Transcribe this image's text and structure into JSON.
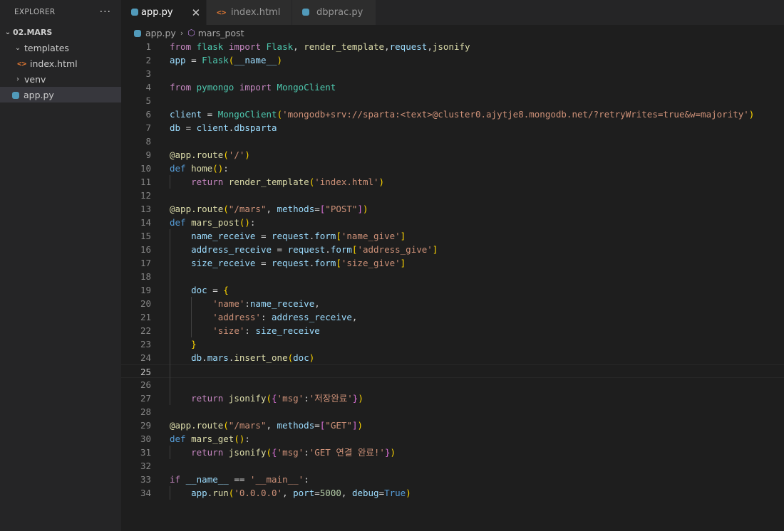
{
  "sidebar": {
    "title": "EXPLORER",
    "more": "···",
    "root": "02.MARS",
    "items": [
      {
        "label": "templates"
      },
      {
        "label": "index.html"
      },
      {
        "label": "venv"
      },
      {
        "label": "app.py"
      }
    ]
  },
  "tabs": [
    {
      "label": "app.py",
      "close": "✕"
    },
    {
      "label": "index.html"
    },
    {
      "label": "dbprac.py"
    }
  ],
  "breadcrumb": {
    "file": "app.py",
    "symbol": "mars_post"
  },
  "editor": {
    "line_numbers": [
      "1",
      "2",
      "3",
      "4",
      "5",
      "6",
      "7",
      "8",
      "9",
      "10",
      "11",
      "12",
      "13",
      "14",
      "15",
      "16",
      "17",
      "18",
      "19",
      "20",
      "21",
      "22",
      "23",
      "24",
      "25",
      "26",
      "27",
      "28",
      "29",
      "30",
      "31",
      "32",
      "33",
      "34"
    ],
    "lines": [
      [
        [
          "kw",
          "from"
        ],
        [
          "plain",
          " "
        ],
        [
          "cls",
          "flask"
        ],
        [
          "plain",
          " "
        ],
        [
          "kw",
          "import"
        ],
        [
          "plain",
          " "
        ],
        [
          "cls",
          "Flask"
        ],
        [
          "plain",
          ", "
        ],
        [
          "fn",
          "render_template"
        ],
        [
          "plain",
          ","
        ],
        [
          "var",
          "request"
        ],
        [
          "plain",
          ","
        ],
        [
          "fn",
          "jsonify"
        ]
      ],
      [
        [
          "var",
          "app"
        ],
        [
          "plain",
          " = "
        ],
        [
          "cls",
          "Flask"
        ],
        [
          "brk1",
          "("
        ],
        [
          "var",
          "__name__"
        ],
        [
          "brk1",
          ")"
        ]
      ],
      [],
      [
        [
          "kw",
          "from"
        ],
        [
          "plain",
          " "
        ],
        [
          "cls",
          "pymongo"
        ],
        [
          "plain",
          " "
        ],
        [
          "kw",
          "import"
        ],
        [
          "plain",
          " "
        ],
        [
          "cls",
          "MongoClient"
        ]
      ],
      [],
      [
        [
          "var",
          "client"
        ],
        [
          "plain",
          " = "
        ],
        [
          "cls",
          "MongoClient"
        ],
        [
          "brk1",
          "("
        ],
        [
          "str",
          "'mongodb+srv://sparta:<text>@cluster0.ajytje8.mongodb.net/?retryWrites=true&w=majority'"
        ],
        [
          "brk1",
          ")"
        ]
      ],
      [
        [
          "var",
          "db"
        ],
        [
          "plain",
          " = "
        ],
        [
          "var",
          "client"
        ],
        [
          "plain",
          "."
        ],
        [
          "var",
          "dbsparta"
        ]
      ],
      [],
      [
        [
          "fn",
          "@app.route"
        ],
        [
          "brk1",
          "("
        ],
        [
          "str",
          "'/'"
        ],
        [
          "brk1",
          ")"
        ]
      ],
      [
        [
          "def",
          "def"
        ],
        [
          "plain",
          " "
        ],
        [
          "fn",
          "home"
        ],
        [
          "brk1",
          "()"
        ],
        [
          "plain",
          ":"
        ]
      ],
      [
        [
          "plain",
          "    "
        ],
        [
          "kw",
          "return"
        ],
        [
          "plain",
          " "
        ],
        [
          "fn",
          "render_template"
        ],
        [
          "brk1",
          "("
        ],
        [
          "str",
          "'index.html'"
        ],
        [
          "brk1",
          ")"
        ]
      ],
      [],
      [
        [
          "fn",
          "@app.route"
        ],
        [
          "brk1",
          "("
        ],
        [
          "str",
          "\"/mars\""
        ],
        [
          "plain",
          ", "
        ],
        [
          "var",
          "methods"
        ],
        [
          "plain",
          "="
        ],
        [
          "brk2",
          "["
        ],
        [
          "str",
          "\"POST\""
        ],
        [
          "brk2",
          "]"
        ],
        [
          "brk1",
          ")"
        ]
      ],
      [
        [
          "def",
          "def"
        ],
        [
          "plain",
          " "
        ],
        [
          "fn",
          "mars_post"
        ],
        [
          "brk1",
          "()"
        ],
        [
          "plain",
          ":"
        ]
      ],
      [
        [
          "plain",
          "    "
        ],
        [
          "var",
          "name_receive"
        ],
        [
          "plain",
          " = "
        ],
        [
          "var",
          "request"
        ],
        [
          "plain",
          "."
        ],
        [
          "var",
          "form"
        ],
        [
          "brk1",
          "["
        ],
        [
          "str",
          "'name_give'"
        ],
        [
          "brk1",
          "]"
        ]
      ],
      [
        [
          "plain",
          "    "
        ],
        [
          "var",
          "address_receive"
        ],
        [
          "plain",
          " = "
        ],
        [
          "var",
          "request"
        ],
        [
          "plain",
          "."
        ],
        [
          "var",
          "form"
        ],
        [
          "brk1",
          "["
        ],
        [
          "str",
          "'address_give'"
        ],
        [
          "brk1",
          "]"
        ]
      ],
      [
        [
          "plain",
          "    "
        ],
        [
          "var",
          "size_receive"
        ],
        [
          "plain",
          " = "
        ],
        [
          "var",
          "request"
        ],
        [
          "plain",
          "."
        ],
        [
          "var",
          "form"
        ],
        [
          "brk1",
          "["
        ],
        [
          "str",
          "'size_give'"
        ],
        [
          "brk1",
          "]"
        ]
      ],
      [],
      [
        [
          "plain",
          "    "
        ],
        [
          "var",
          "doc"
        ],
        [
          "plain",
          " = "
        ],
        [
          "brk1",
          "{"
        ]
      ],
      [
        [
          "plain",
          "        "
        ],
        [
          "str",
          "'name'"
        ],
        [
          "plain",
          ":"
        ],
        [
          "var",
          "name_receive"
        ],
        [
          "plain",
          ","
        ]
      ],
      [
        [
          "plain",
          "        "
        ],
        [
          "str",
          "'address'"
        ],
        [
          "plain",
          ": "
        ],
        [
          "var",
          "address_receive"
        ],
        [
          "plain",
          ","
        ]
      ],
      [
        [
          "plain",
          "        "
        ],
        [
          "str",
          "'size'"
        ],
        [
          "plain",
          ": "
        ],
        [
          "var",
          "size_receive"
        ]
      ],
      [
        [
          "plain",
          "    "
        ],
        [
          "brk1",
          "}"
        ]
      ],
      [
        [
          "plain",
          "    "
        ],
        [
          "var",
          "db"
        ],
        [
          "plain",
          "."
        ],
        [
          "var",
          "mars"
        ],
        [
          "plain",
          "."
        ],
        [
          "fn",
          "insert_one"
        ],
        [
          "brk1",
          "("
        ],
        [
          "var",
          "doc"
        ],
        [
          "brk1",
          ")"
        ]
      ],
      [],
      [],
      [
        [
          "plain",
          "    "
        ],
        [
          "kw",
          "return"
        ],
        [
          "plain",
          " "
        ],
        [
          "fn",
          "jsonify"
        ],
        [
          "brk1",
          "("
        ],
        [
          "brk2",
          "{"
        ],
        [
          "str",
          "'msg'"
        ],
        [
          "plain",
          ":"
        ],
        [
          "str",
          "'저장완료'"
        ],
        [
          "brk2",
          "}"
        ],
        [
          "brk1",
          ")"
        ]
      ],
      [],
      [
        [
          "fn",
          "@app.route"
        ],
        [
          "brk1",
          "("
        ],
        [
          "str",
          "\"/mars\""
        ],
        [
          "plain",
          ", "
        ],
        [
          "var",
          "methods"
        ],
        [
          "plain",
          "="
        ],
        [
          "brk2",
          "["
        ],
        [
          "str",
          "\"GET\""
        ],
        [
          "brk2",
          "]"
        ],
        [
          "brk1",
          ")"
        ]
      ],
      [
        [
          "def",
          "def"
        ],
        [
          "plain",
          " "
        ],
        [
          "fn",
          "mars_get"
        ],
        [
          "brk1",
          "()"
        ],
        [
          "plain",
          ":"
        ]
      ],
      [
        [
          "plain",
          "    "
        ],
        [
          "kw",
          "return"
        ],
        [
          "plain",
          " "
        ],
        [
          "fn",
          "jsonify"
        ],
        [
          "brk1",
          "("
        ],
        [
          "brk2",
          "{"
        ],
        [
          "str",
          "'msg'"
        ],
        [
          "plain",
          ":"
        ],
        [
          "str",
          "'GET 연결 완료!'"
        ],
        [
          "brk2",
          "}"
        ],
        [
          "brk1",
          ")"
        ]
      ],
      [],
      [
        [
          "kw",
          "if"
        ],
        [
          "plain",
          " "
        ],
        [
          "var",
          "__name__"
        ],
        [
          "plain",
          " == "
        ],
        [
          "str",
          "'__main__'"
        ],
        [
          "plain",
          ":"
        ]
      ],
      [
        [
          "plain",
          "    "
        ],
        [
          "var",
          "app"
        ],
        [
          "plain",
          "."
        ],
        [
          "fn",
          "run"
        ],
        [
          "brk1",
          "("
        ],
        [
          "str",
          "'0.0.0.0'"
        ],
        [
          "plain",
          ", "
        ],
        [
          "var",
          "port"
        ],
        [
          "plain",
          "="
        ],
        [
          "num",
          "5000"
        ],
        [
          "plain",
          ", "
        ],
        [
          "var",
          "debug"
        ],
        [
          "plain",
          "="
        ],
        [
          "def",
          "True"
        ],
        [
          "brk1",
          ")"
        ]
      ]
    ]
  }
}
